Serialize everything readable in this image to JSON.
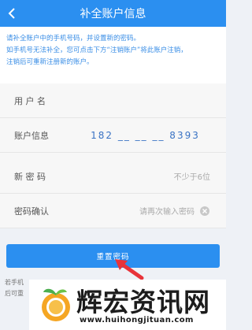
{
  "header": {
    "title": "补全账户信息"
  },
  "notice": {
    "lines": [
      "请补全账户中的手机号码，并设置新的密码。",
      "如手机号无法补全，您可点击下方“注销账户”将此账户注销，",
      "注销后可重新注册新的账户。"
    ]
  },
  "form": {
    "username": {
      "label": "用 户 名",
      "value": ""
    },
    "account": {
      "label": "账户信息",
      "value": "182 __ __ __ 8393"
    },
    "new_password": {
      "label": "新 密 码",
      "placeholder": "不少于6位"
    },
    "confirm_password": {
      "label": "密码确认",
      "placeholder": "请再次输入密码"
    }
  },
  "button": {
    "label": "重置密码"
  },
  "footnote": {
    "lines": [
      "若手机",
      "后可重"
    ]
  },
  "watermark": {
    "title": "辉宏资讯网",
    "url": "www.huihongjituan.com"
  },
  "colors": {
    "primary": "#2b8ff0",
    "notice_text": "#3a8ee6",
    "arrow": "#e8333a"
  }
}
